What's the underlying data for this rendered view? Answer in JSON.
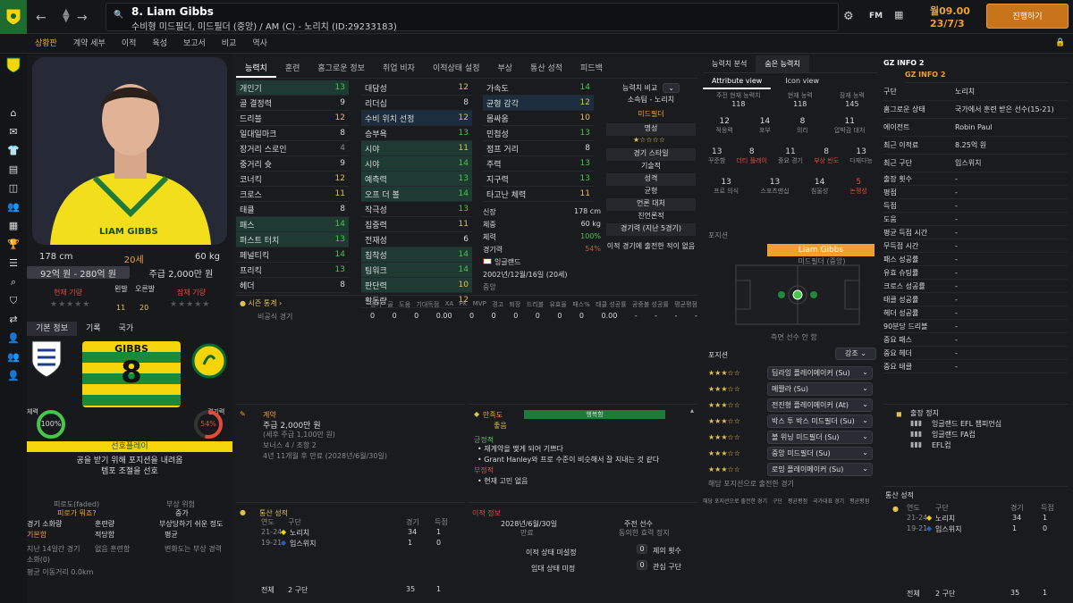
{
  "header": {
    "player_name": "8. Liam Gibbs",
    "player_sub": "수비형 미드필더, 미드필더 (중앙) / AM (C) - 노리치 (ID:29233183)",
    "brand": "FM",
    "date_line1": "월09.00",
    "date_line2": "23/7/3",
    "continue_label": "진행하기"
  },
  "nav_tabs": [
    "상황판",
    "계약 세부",
    "이적",
    "육성",
    "보고서",
    "비교",
    "역사"
  ],
  "profile": {
    "height": "178 cm",
    "age": "20세",
    "weight": "60 kg",
    "value": "92억 원 - 280억 원",
    "wage": "주급 2,000만 원",
    "current_ability_label": "현재 기량",
    "left_foot_label": "왼발",
    "right_foot_label": "오른발",
    "left_foot_val": "11",
    "right_foot_val": "20",
    "potential_label": "잠재 기량"
  },
  "identity_tabs": [
    "기본 정보",
    "기록",
    "국가"
  ],
  "shirt": {
    "name": "GIBBS",
    "number": "8"
  },
  "fitness": {
    "left_label": "체력",
    "left_val": "100%",
    "right_label": "경기력",
    "right_val": "54%",
    "role_label": "선호플레이",
    "pref1": "공을 받기 위해 포지션을 내려옴",
    "pref2": "템포 조절을 선호"
  },
  "lower_left": {
    "c1": "피로도(faded)",
    "c2": "피로가 뭐죠?",
    "injury_risk_label": "부상 위험",
    "injury_risk_val": "중가",
    "match_sharpness_label": "경기 소화량",
    "match_sharpness_val": "기본함",
    "training_label": "훈련량",
    "training_val": "적당함",
    "injury_prone_label": "부상당하기 쉬운 정도",
    "injury_prone_val": "평균",
    "last14_label": "지난 14일간 경기",
    "last14_val": "소화(0)",
    "no_training": "없음 훈련함",
    "recent_inj": "변화도는 부상 경력",
    "distance": "평균 이동거리 0.0km"
  },
  "attr_tabs": [
    "능력치",
    "훈련",
    "홈그로운 정보",
    "취업 비자",
    "이적상태 설정",
    "부상",
    "통산 성적",
    "피드백"
  ],
  "technical": [
    [
      "개인기",
      "13"
    ],
    [
      "골 결정력",
      "9"
    ],
    [
      "드리블",
      "12"
    ],
    [
      "일대일마크",
      "8"
    ],
    [
      "장거리 스로인",
      "4"
    ],
    [
      "중거리 슛",
      "9"
    ],
    [
      "코너킥",
      "12"
    ],
    [
      "크로스",
      "11"
    ],
    [
      "태클",
      "8"
    ],
    [
      "패스",
      "14"
    ],
    [
      "퍼스트 터치",
      "13"
    ],
    [
      "페널티킥",
      "14"
    ],
    [
      "프리킥",
      "13"
    ],
    [
      "헤더",
      "8"
    ]
  ],
  "mental": [
    [
      "대담성",
      "12"
    ],
    [
      "리더십",
      "8"
    ],
    [
      "수비 위치 선정",
      "12"
    ],
    [
      "승부욕",
      "13"
    ],
    [
      "시야",
      "11"
    ],
    [
      "시야",
      "14"
    ],
    [
      "예측력",
      "13"
    ],
    [
      "오프 더 볼",
      "14"
    ],
    [
      "작극성",
      "13"
    ],
    [
      "집중력",
      "11"
    ],
    [
      "전재성",
      "6"
    ],
    [
      "침착성",
      "14"
    ],
    [
      "팀워크",
      "14"
    ],
    [
      "판단력",
      "10"
    ],
    [
      "활동량",
      "12"
    ]
  ],
  "physical": [
    [
      "가속도",
      "14"
    ],
    [
      "균형 감각",
      "12"
    ],
    [
      "몸싸움",
      "10"
    ],
    [
      "민첩성",
      "13"
    ],
    [
      "점프 거리",
      "8"
    ],
    [
      "주력",
      "13"
    ],
    [
      "지구력",
      "13"
    ],
    [
      "타고난 체력",
      "11"
    ]
  ],
  "bio": {
    "h_label": "신장",
    "h_val": "178 cm",
    "w_label": "체중",
    "w_val": "60 kg",
    "c_label": "체력",
    "c_val": "100%",
    "s_label": "경기력",
    "s_val": "54%",
    "nat": "잉글랜드",
    "dob": "2002년/12월/16일 (20세)",
    "pos": "중앙"
  },
  "compare": {
    "title": "능력치 비교",
    "club": "소속팀 - 노리치",
    "role": "미드필더",
    "rep_label": "명성",
    "style_label": "경기 스타일",
    "style_val": "기술적",
    "pers_label": "성격",
    "pers_val": "균형",
    "media_label": "언론 대처",
    "media_val": "친언론적",
    "form_label": "경기력 (지난 5경기)",
    "form_note": "이적 경기에 출전한 적이 없음"
  },
  "season": {
    "title": "시즌 통계",
    "cols": [
      "경기",
      "골",
      "도움",
      "기대득점",
      "XA",
      "PK",
      "MVP",
      "경고",
      "퇴장",
      "드리블",
      "유효율",
      "패스%",
      "태클 성공률",
      "공중볼 성공률",
      "평균평점"
    ],
    "row_label": "비공식 경기",
    "row_vals": [
      "0",
      "0",
      "0",
      "0.00",
      "0",
      "0",
      "0",
      "0",
      "0",
      "0",
      "0.00",
      "-",
      "-",
      "-",
      "-"
    ]
  },
  "contract": {
    "title": "계약",
    "wage": "주급 2,000만 원",
    "sub": "(세후 주급 1,100만 원)",
    "bonus": "보너스 4 / 조항 2",
    "length": "4년 11개월 후 만료 (2028년/6월/30일)"
  },
  "happiness": {
    "title": "만족도",
    "status": "행복함",
    "mood": "좋음",
    "pos_label": "긍정적",
    "pos1": "재계약을 맺게 되어 기쁘다",
    "pos2": "Grant Hanley와 프로 수준이 비슷해서 잘 지내는 것 같다",
    "neg_label": "부정적",
    "neg1": "현재 고민 없음"
  },
  "career": {
    "title": "통산 성적",
    "col_year": "연도",
    "col_club": "구단",
    "col_apps": "경기",
    "col_goals": "득점",
    "rows": [
      [
        "21-24",
        "노리치",
        "34",
        "1"
      ],
      [
        "19-21",
        "입스위치",
        "1",
        "0"
      ]
    ],
    "total_label": "전체",
    "total_clubs": "2 구단",
    "total_apps": "35",
    "total_goals": "1"
  },
  "transfer": {
    "title": "이적 정보",
    "date": "2028년/6월/30일",
    "date_lbl": "만료",
    "status": "주전 선수",
    "status_lbl": "동의한 효력 정지",
    "unset": "이적 상태 미설정",
    "unset2": "임대 상태 미정",
    "offers": "0",
    "offers_lbl": "제의 횟수",
    "interest": "0",
    "interest_lbl": "관심 구단"
  },
  "analysis": {
    "tabs": [
      "능력치 분석",
      "숨은 능력치"
    ],
    "views": [
      "Attribute view",
      "Icon view"
    ],
    "top": [
      [
        "주전 현재 능력치",
        "118"
      ],
      [
        "현재 능력",
        "118"
      ],
      [
        "잠재 능력",
        "145"
      ]
    ],
    "r1": [
      [
        "12",
        "적응력"
      ],
      [
        "14",
        "포부"
      ],
      [
        "8",
        "의리"
      ],
      [
        "11",
        "압박감 대처"
      ]
    ],
    "r2": [
      [
        "13",
        "꾸준함"
      ],
      [
        "8",
        "더티 플레이"
      ],
      [
        "11",
        "중요 경기"
      ],
      [
        "8",
        "부상 빈도"
      ],
      [
        "13",
        "다재다능"
      ]
    ],
    "r3": [
      [
        "13",
        "프로 의식"
      ],
      [
        "13",
        "스포츠맨십"
      ],
      [
        "14",
        "침울성"
      ],
      [
        "5",
        "논쟁성"
      ]
    ]
  },
  "position": {
    "title": "포지션",
    "name": "Liam Gibbs",
    "role": "미드필더 (중앙)",
    "desc": "측면 선수 안 함"
  },
  "roles": {
    "title": "포지션",
    "filter": "강조",
    "items": [
      "딥라잉 플레이메이커 (Su)",
      "메짤라 (Su)",
      "전진형 플레이메이커 (At)",
      "박스 투 박스 미드필더 (Su)",
      "볼 위닝 미드필더 (Su)",
      "중앙 미드필더 (Su)",
      "로밍 플레이메이커 (Su)"
    ],
    "played_title": "해당 포지션으로 출전한 경기",
    "played_cols": [
      "해당 포지션으로 출전한 경기",
      "구단",
      "평균평점",
      "국가대표 경기",
      "평균평점"
    ]
  },
  "gz": {
    "title": "GZ INFO 2",
    "sub": "GZ INFO 2",
    "fields": [
      [
        "구단",
        "노리치"
      ],
      [
        "홈그로운 상태",
        "국가에서 훈련 받은 선수(15-21)"
      ],
      [
        "에이전트",
        "Robin Paul"
      ],
      [
        "최근 이적료",
        "8.25억 원"
      ],
      [
        "최근 구단",
        "입스위치"
      ],
      [
        "출장 횟수",
        "-"
      ],
      [
        "평점",
        "-"
      ],
      [
        "득점",
        "-"
      ],
      [
        "도움",
        "-"
      ],
      [
        "평균 득점 시간",
        "-"
      ],
      [
        "무득점 시간",
        "-"
      ],
      [
        "패스 성공률",
        "-"
      ],
      [
        "유효 슈팅률",
        "-"
      ],
      [
        "크로스 성공률",
        "-"
      ],
      [
        "태클 성공률",
        "-"
      ],
      [
        "헤더 성공률",
        "-"
      ],
      [
        "90분당 드리블",
        "-"
      ],
      [
        "중요 패스",
        "-"
      ],
      [
        "중요 헤더",
        "-"
      ],
      [
        "중요 태클",
        "-"
      ]
    ]
  },
  "suspension": {
    "title": "출장 정지",
    "items": [
      "잉글랜드 EFL 챔피언십",
      "잉글랜드 FA컵",
      "EFL컵"
    ]
  },
  "colors": {
    "accent": "#f0a030",
    "green": "#45c74a",
    "gold": "#e0c050",
    "bg": "#1a1b1f"
  }
}
